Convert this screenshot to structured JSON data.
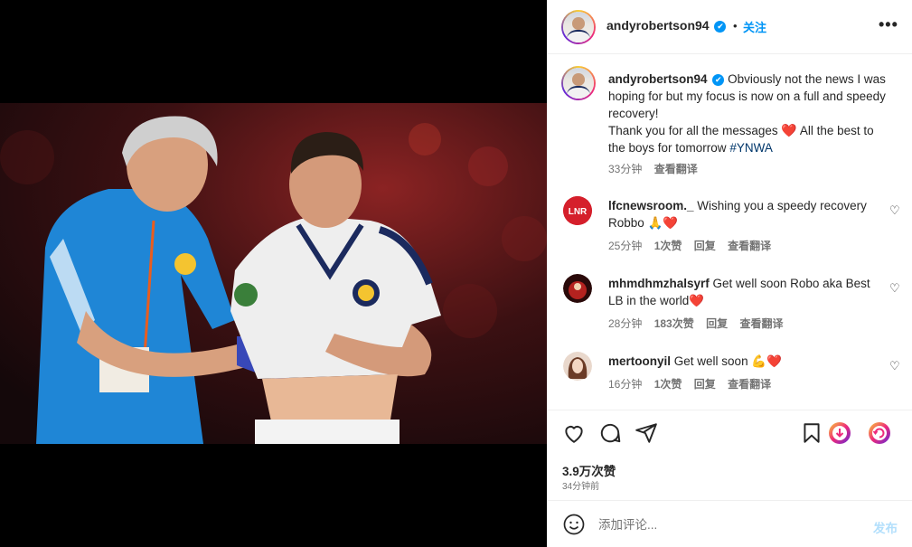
{
  "header": {
    "username": "andyrobertson94",
    "verified_mark": "✔",
    "separator": "•",
    "follow_label": "关注",
    "more_label": "•••"
  },
  "caption": {
    "username": "andyrobertson94",
    "line1": "Obviously not the news I was hoping for but my focus is now on a full and speedy recovery!",
    "line2a": "Thank you for all the messages",
    "heart": "❤️",
    "line2b": "All the best to the boys for tomorrow",
    "hashtag": "#YNWA",
    "time": "33分钟",
    "translate": "查看翻译"
  },
  "comments": [
    {
      "username": "lfcnewsroom._",
      "text": "Wishing you a speedy recovery Robbo 🙏❤️",
      "time": "25分钟",
      "likes": "1次赞",
      "reply": "回复",
      "translate": "查看翻译",
      "avatar_icon": "lnr-logo-icon"
    },
    {
      "username": "mhmdhmzhalsyrf",
      "text": "Get well soon Robo aka Best LB in the world❤️",
      "time": "28分钟",
      "likes": "183次赞",
      "reply": "回复",
      "translate": "查看翻译",
      "avatar_icon": "stadium-avatar-icon"
    },
    {
      "username": "mertoonyil",
      "text": "Get well soon 💪❤️",
      "time": "16分钟",
      "likes": "1次赞",
      "reply": "回复",
      "translate": "查看翻译",
      "avatar_icon": "portrait-avatar-icon"
    }
  ],
  "actions": {
    "icons": [
      "heart-icon",
      "comment-icon",
      "share-icon",
      "bookmark-icon",
      "download-icon",
      "refresh-icon"
    ]
  },
  "likes_count": "3.9万次赞",
  "posted_ago": "34分钟前",
  "add_comment": {
    "placeholder": "添加评论...",
    "post_label": "发布"
  },
  "colors": {
    "accent": "#0095f6",
    "like_red": "#ed1c2e",
    "hashtag": "#00376b",
    "muted": "#737373"
  }
}
